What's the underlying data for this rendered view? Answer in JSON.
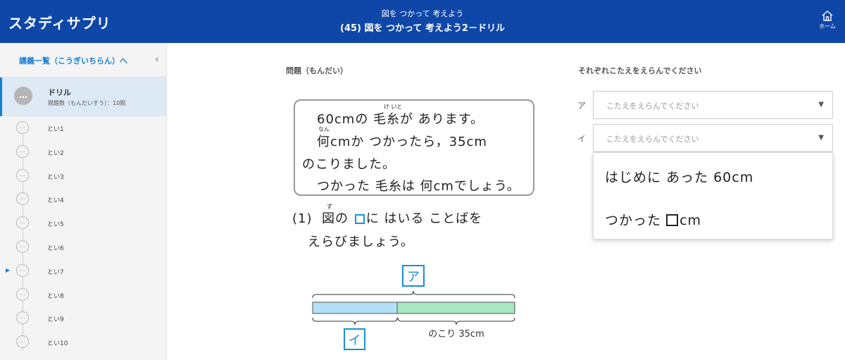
{
  "header": {
    "logo": "スタディサプリ",
    "subtitle": "図を つかって 考えよう",
    "title": "(45) 図を つかって 考えよう2－ドリル",
    "home_label": "ホーム"
  },
  "sidebar": {
    "back_link": "講義一覧（こうぎいちらん）へ",
    "drill": {
      "icon_text": "…",
      "title": "ドリル",
      "subtitle": "問題数（もんだいすう）：10問"
    },
    "questions": [
      {
        "label": "とい1",
        "current": false
      },
      {
        "label": "とい2",
        "current": false
      },
      {
        "label": "とい3",
        "current": false
      },
      {
        "label": "とい4",
        "current": false
      },
      {
        "label": "とい5",
        "current": false
      },
      {
        "label": "とい6",
        "current": false
      },
      {
        "label": "とい7",
        "current": true
      },
      {
        "label": "とい8",
        "current": false
      },
      {
        "label": "とい9",
        "current": false
      },
      {
        "label": "とい10",
        "current": false
      }
    ],
    "current_marker": "▶",
    "circle_text": "…"
  },
  "problem": {
    "heading": "問題（もんだい）",
    "lines": [
      "60cmの 毛糸が あります。",
      "何cmか つかったら，35cm",
      "のこりました。",
      "つかった 毛糸は 何cmでしょう。"
    ],
    "ruby_keito": "け いと",
    "ruby_nan": "なん",
    "ruby_zu": "ず",
    "question_num": "(1)",
    "question_part1": "図の",
    "question_part2": "に はいる ことばを",
    "question_line2": "えらびましょう。",
    "diagram": {
      "label_top": "ア",
      "label_bottom": "イ",
      "remaining_label": "のこり 35cm"
    }
  },
  "answers": {
    "heading": "それぞれこたえをえらんでください",
    "rows": [
      {
        "key": "ア",
        "placeholder": "こたえをえらんでください"
      },
      {
        "key": "イ",
        "placeholder": "こたえをえらんでください"
      }
    ],
    "options": [
      "はじめに あった 60cm",
      "つかった",
      "cm"
    ]
  },
  "colors": {
    "header_bg": "#0f47a9",
    "accent": "#1a7fd4",
    "bar_blue": "#b3e0f7",
    "bar_green": "#a8e6c2"
  }
}
